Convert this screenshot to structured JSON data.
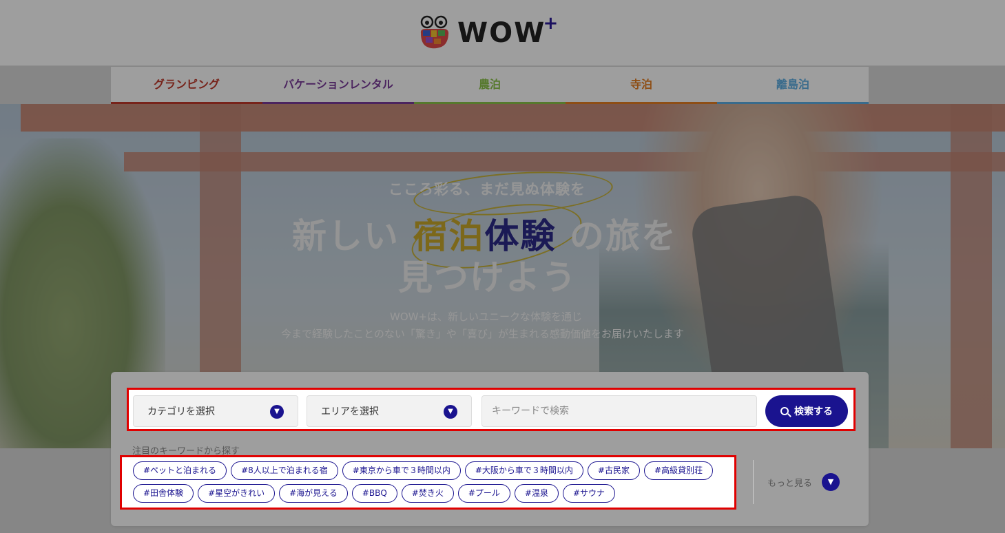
{
  "header": {
    "logo_text": "WOW",
    "logo_plus": "+"
  },
  "nav": {
    "items": [
      {
        "label": "グランピング",
        "color": "#c0392b"
      },
      {
        "label": "バケーションレンタル",
        "color": "#7a3b9a"
      },
      {
        "label": "農泊",
        "color": "#8bc34a"
      },
      {
        "label": "寺泊",
        "color": "#e67e22"
      },
      {
        "label": "離島泊",
        "color": "#5dade2"
      }
    ]
  },
  "hero": {
    "catch": "こころ彩る、まだ見ぬ体験を",
    "title_pre": "新しい ",
    "title_hl1": "宿泊",
    "title_hl2": "体験",
    "title_post": " の旅を",
    "title_line2": "見つけよう",
    "sub1": "WOW+は、新しいユニークな体験を通じ",
    "sub2": "今まで経験したことのない「驚き」や「喜び」が生まれる感動価値をお届けいたします"
  },
  "search": {
    "category_label": "カテゴリを選択",
    "area_label": "エリアを選択",
    "keyword_placeholder": "キーワードで検索",
    "button_label": "検索する"
  },
  "keywords": {
    "label": "注目のキーワードから探す",
    "row1": [
      "#ペットと泊まれる",
      "#8人以上で泊まれる宿",
      "#東京から車で３時間以内",
      "#大阪から車で３時間以内",
      "#古民家",
      "#高級貸別荘"
    ],
    "row2": [
      "#田舎体験",
      "#星空がきれい",
      "#海が見える",
      "#BBQ",
      "#焚き火",
      "#プール",
      "#温泉",
      "#サウナ"
    ],
    "more_label": "もっと見る"
  }
}
